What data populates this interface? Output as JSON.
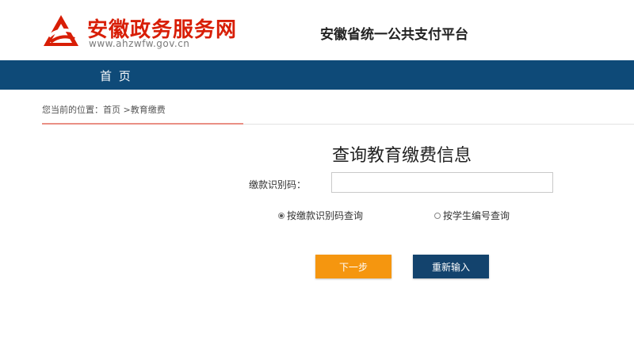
{
  "header": {
    "logo_title": "安徽政务服务网",
    "logo_url": "www.ahzwfw.gov.cn",
    "platform_title": "安徽省统一公共支付平台"
  },
  "nav": {
    "home_label": "首 页"
  },
  "breadcrumb": {
    "prefix": "您当前的位置：",
    "home": "首页",
    "separator": " >",
    "current": "教育缴费"
  },
  "form": {
    "title": "查询教育缴费信息",
    "field_label": "缴款识别码：",
    "field_value": "",
    "radio_options": [
      {
        "label": "按缴款识别码查询",
        "checked": true
      },
      {
        "label": "按学生编号查询",
        "checked": false
      }
    ],
    "next_label": "下一步",
    "reset_label": "重新输入"
  },
  "colors": {
    "brand_red": "#d81e06",
    "nav_blue": "#0e4a78",
    "next_orange": "#f5960f",
    "reset_navy": "#13436d"
  }
}
